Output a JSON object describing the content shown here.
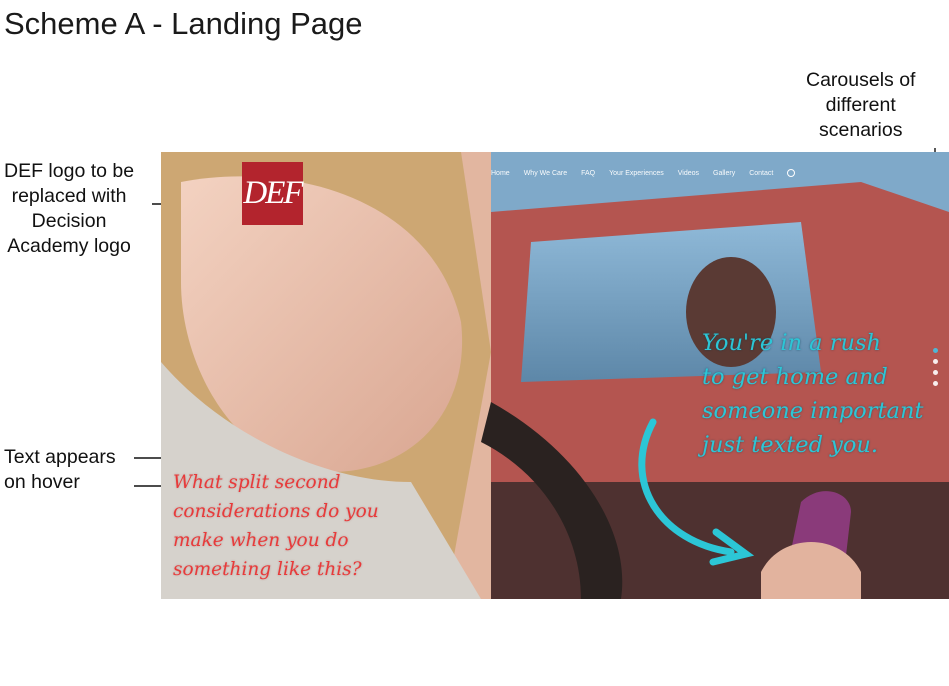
{
  "title": "Scheme A - Landing Page",
  "annotations": {
    "logo_note": [
      "DEF logo to be",
      "replaced with",
      "Decision",
      "Academy logo"
    ],
    "carousel_note": [
      "Carousels of",
      "different",
      "scenarios"
    ],
    "hover_note": [
      "Text appears",
      "on hover"
    ]
  },
  "hero": {
    "logo_text": "DEF",
    "nav": [
      "Home",
      "Why We Care",
      "FAQ",
      "Your Experiences",
      "Videos",
      "Gallery",
      "Contact"
    ],
    "carousel_dots": 4,
    "active_dot": 0,
    "scenario_text": [
      "You're in a rush",
      "to get home and",
      "someone important",
      "just texted you."
    ],
    "hover_text": [
      "What split second",
      "considerations do you",
      "make when you do",
      "something like this?"
    ]
  },
  "colors": {
    "logo_red": "#b3242d",
    "scenario_cyan": "#2cc6d6",
    "hover_red": "#e83a3a",
    "active_dot": "#4fb6d4"
  }
}
